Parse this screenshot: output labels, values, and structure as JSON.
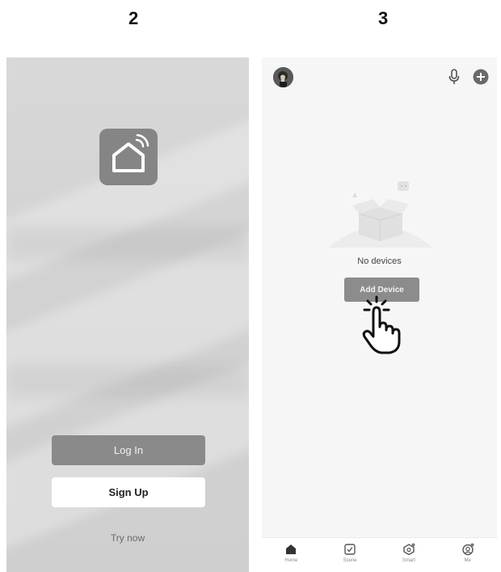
{
  "steps": {
    "left": "2",
    "right": "3"
  },
  "login_screen": {
    "login_label": "Log In",
    "signup_label": "Sign Up",
    "try_now_label": "Try now"
  },
  "home_screen": {
    "empty_text": "No devices",
    "add_device_label": "Add Device",
    "tabs": [
      {
        "label": "Home",
        "icon": "home-icon"
      },
      {
        "label": "Scene",
        "icon": "scene-checkbox-icon"
      },
      {
        "label": "Smart",
        "icon": "smart-icon"
      },
      {
        "label": "Me",
        "icon": "me-icon"
      }
    ]
  },
  "colors": {
    "button_gray": "#8a8a8a",
    "screen_bg": "#f6f6f6",
    "login_bg": "#d4d4d4"
  }
}
